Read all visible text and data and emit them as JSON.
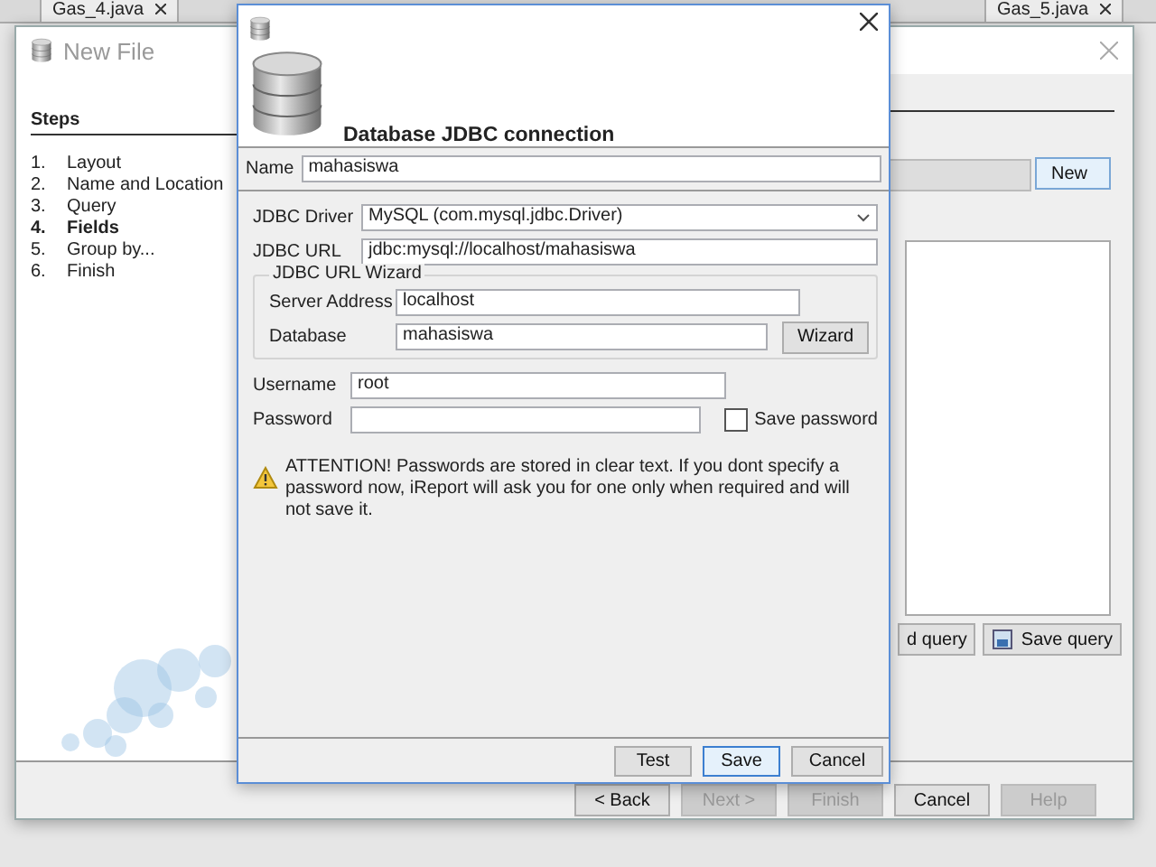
{
  "ide_tabs": [
    {
      "label": "Gas_4.java"
    },
    {
      "label": "Gas_5.java"
    }
  ],
  "wizard": {
    "title": "New File",
    "steps_heading": "Steps",
    "steps": [
      {
        "number": "1.",
        "label": "Layout",
        "selected": false
      },
      {
        "number": "2.",
        "label": "Name and Location",
        "selected": false
      },
      {
        "number": "3.",
        "label": "Query",
        "selected": false
      },
      {
        "number": "4.",
        "label": "Fields",
        "selected": true
      },
      {
        "number": "5.",
        "label": "Group by...",
        "selected": false
      },
      {
        "number": "6.",
        "label": "Finish",
        "selected": false
      }
    ],
    "new_button": "New",
    "query_buttons": [
      {
        "label": "d query",
        "kind": "plain"
      },
      {
        "label": "Save query",
        "kind": "save"
      }
    ],
    "nav_buttons": [
      {
        "label": "< Back",
        "disabled": false
      },
      {
        "label": "Next >",
        "disabled": true
      },
      {
        "label": "Finish",
        "disabled": true
      },
      {
        "label": "Cancel",
        "disabled": false
      },
      {
        "label": "Help",
        "disabled": true
      }
    ]
  },
  "dialog": {
    "title": "Database JDBC connection",
    "name": {
      "label": "Name",
      "value": "mahasiswa"
    },
    "driver": {
      "label": "JDBC Driver",
      "value": "MySQL (com.mysql.jdbc.Driver)"
    },
    "url": {
      "label": "JDBC URL",
      "value": "jdbc:mysql://localhost/mahasiswa"
    },
    "url_wizard": {
      "title": "JDBC URL Wizard",
      "server": {
        "label": "Server Address",
        "value": "localhost"
      },
      "database": {
        "label": "Database",
        "value": "mahasiswa"
      },
      "button": "Wizard"
    },
    "username": {
      "label": "Username",
      "value": "root"
    },
    "password": {
      "label": "Password"
    },
    "save_password": {
      "label": "Save password",
      "checked": false
    },
    "warning": "ATTENTION! Passwords are stored in clear text. If you dont specify a password now, iReport will ask you for one only when required and will not save it.",
    "buttons": [
      {
        "label": "Test",
        "default": false
      },
      {
        "label": "Save",
        "default": true
      },
      {
        "label": "Cancel",
        "default": false
      }
    ]
  }
}
